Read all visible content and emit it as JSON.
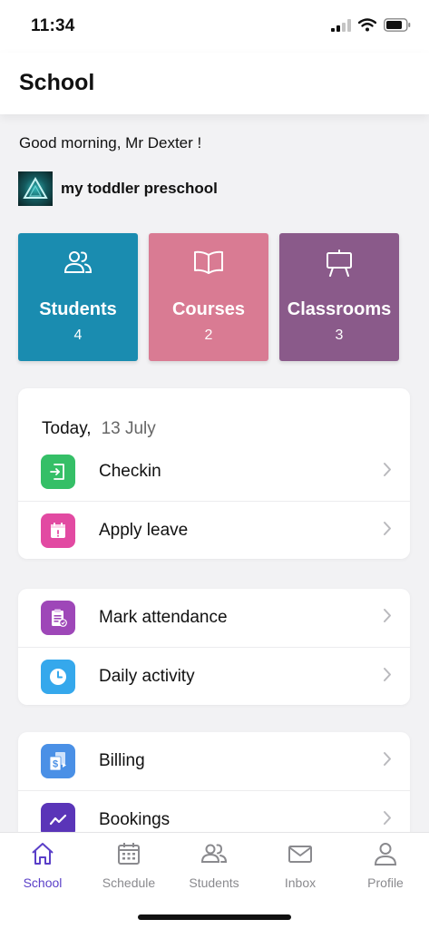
{
  "status_bar": {
    "time": "11:34"
  },
  "header": {
    "title": "School"
  },
  "greeting": "Good morning, Mr Dexter !",
  "school": {
    "name": "my toddler preschool"
  },
  "tiles": [
    {
      "label": "Students",
      "count": "4",
      "color": "#1a8cb0",
      "icon": "users-icon"
    },
    {
      "label": "Courses",
      "count": "2",
      "color": "#d97b93",
      "icon": "book-icon"
    },
    {
      "label": "Classrooms",
      "count": "3",
      "color": "#8a5a8a",
      "icon": "easel-icon"
    }
  ],
  "today_card": {
    "today_label": "Today,",
    "date": "13 July",
    "items": [
      {
        "label": "Checkin",
        "icon": "checkin-icon",
        "color": "#35bf67"
      },
      {
        "label": "Apply leave",
        "icon": "calendar-alert-icon",
        "color": "#e24aa2"
      }
    ]
  },
  "attendance_card": {
    "items": [
      {
        "label": "Mark attendance",
        "icon": "clipboard-check-icon",
        "color": "#9e47b8"
      },
      {
        "label": "Daily activity",
        "icon": "clock-icon",
        "color": "#35a8ec"
      }
    ]
  },
  "billing_card": {
    "items": [
      {
        "label": "Billing",
        "icon": "billing-icon",
        "color": "#4a90e6"
      },
      {
        "label": "Bookings",
        "icon": "trend-icon",
        "color": "#5a35b8"
      }
    ]
  },
  "tab_bar": {
    "active_color": "#5a3fc8",
    "tabs": [
      {
        "label": "School",
        "icon": "home-icon",
        "active": true
      },
      {
        "label": "Schedule",
        "icon": "calendar-icon",
        "active": false
      },
      {
        "label": "Students",
        "icon": "users-icon",
        "active": false
      },
      {
        "label": "Inbox",
        "icon": "mail-icon",
        "active": false
      },
      {
        "label": "Profile",
        "icon": "person-icon",
        "active": false
      }
    ]
  }
}
